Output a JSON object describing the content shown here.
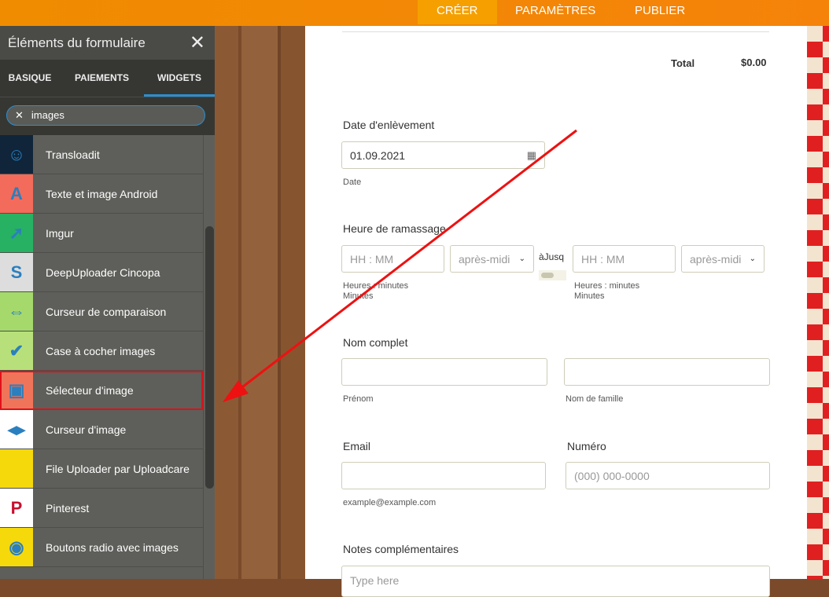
{
  "topbar": {
    "tabs": [
      "CRÉER",
      "PARAMÈTRES",
      "PUBLIER"
    ]
  },
  "panel": {
    "title": "Éléments du formulaire",
    "tabs": [
      "BASIQUE",
      "PAIEMENTS",
      "WIDGETS"
    ],
    "search": "images",
    "items": [
      {
        "label": "Transloadit",
        "icon": "robot-icon",
        "color": "#10253a"
      },
      {
        "label": "Texte et image Android",
        "icon": "android-text-image-icon",
        "color": "#f26b5b"
      },
      {
        "label": "Imgur",
        "icon": "imgur-icon",
        "color": "#27b163"
      },
      {
        "label": "DeepUploader Cincopa",
        "icon": "cincopa-icon",
        "color": "#dddddd"
      },
      {
        "label": "Curseur de comparaison",
        "icon": "comparison-slider-icon",
        "color": "#a5d96b"
      },
      {
        "label": "Case à cocher images",
        "icon": "image-checkbox-icon",
        "color": "#b8e07a"
      },
      {
        "label": "Sélecteur d'image",
        "icon": "image-picker-icon",
        "color": "#f0745a"
      },
      {
        "label": "Curseur d'image",
        "icon": "image-slider-icon",
        "color": "#ffffff"
      },
      {
        "label": "File Uploader par Uploadcare",
        "icon": "uploadcare-icon",
        "color": "#f5d90a"
      },
      {
        "label": "Pinterest",
        "icon": "pinterest-icon",
        "color": "#ffffff"
      },
      {
        "label": "Boutons radio avec images",
        "icon": "image-radio-icon",
        "color": "#f5d90a"
      }
    ]
  },
  "form": {
    "total_label": "Total",
    "total_value": "$0.00",
    "date_label": "Date d'enlèvement",
    "date_value": "01.09.2021",
    "date_sub": "Date",
    "time_label": "Heure de ramassage",
    "time_placeholder": "HH : MM",
    "ampm": "après-midi",
    "until": "àJusq",
    "hm_sub": "Heures : minutes",
    "min_sub": "Minutes",
    "name_label": "Nom complet",
    "first_sub": "Prénom",
    "last_sub": "Nom de famille",
    "email_label": "Email",
    "email_sub": "example@example.com",
    "phone_label": "Numéro",
    "phone_placeholder": "(000) 000-0000",
    "notes_label": "Notes complémentaires",
    "notes_placeholder": "Type here"
  }
}
